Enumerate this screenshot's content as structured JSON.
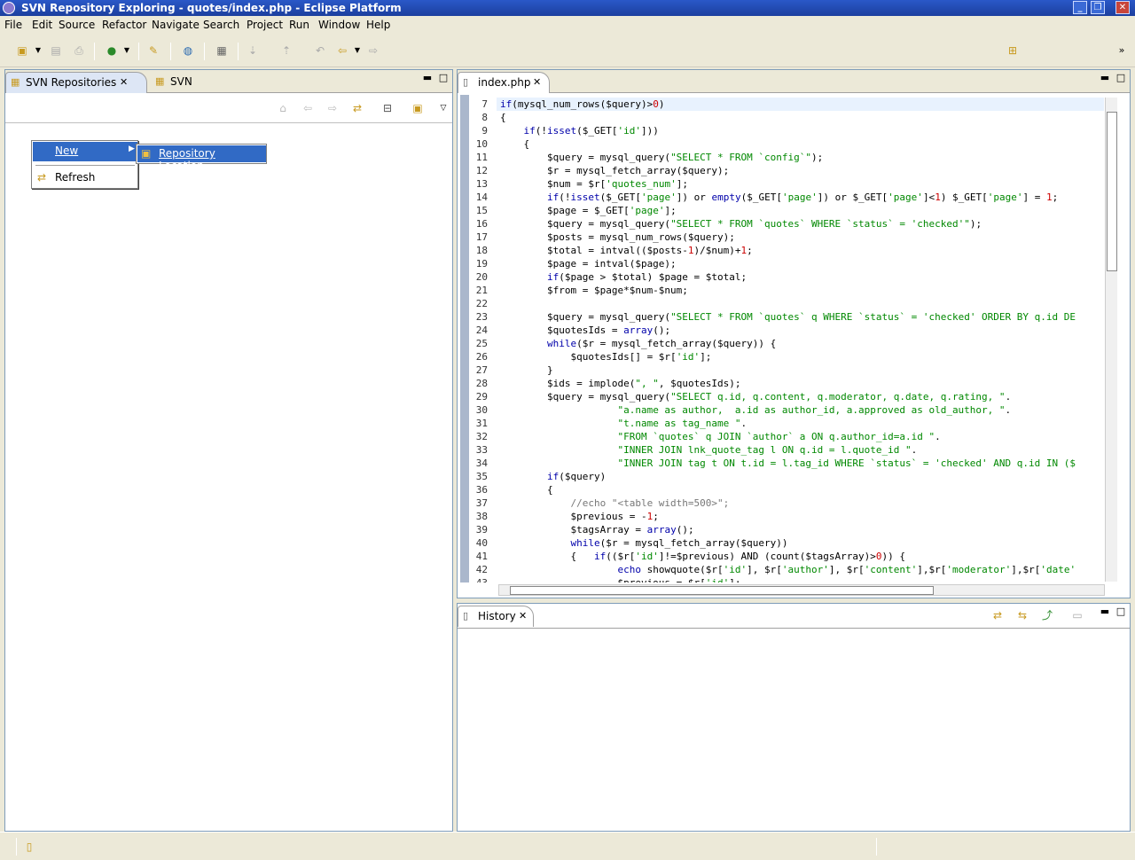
{
  "window": {
    "title": "SVN Repository Exploring - quotes/index.php - Eclipse Platform"
  },
  "menu": [
    "File",
    "Edit",
    "Source",
    "Refactor",
    "Navigate",
    "Search",
    "Project",
    "Run",
    "Window",
    "Help"
  ],
  "left_panel": {
    "tabs": [
      {
        "label": "SVN Repositories"
      },
      {
        "label": "SVN Annotate"
      }
    ],
    "context_menu": {
      "new_label": "New",
      "refresh_label": "Refresh",
      "submenu_item": "Repository Location..."
    }
  },
  "editor": {
    "tab_label": "index.php",
    "lines": [
      {
        "n": "7",
        "t": "if(mysql_num_rows($query)>0)"
      },
      {
        "n": "8",
        "t": "{"
      },
      {
        "n": "9",
        "t": "    if(!isset($_GET['id']))"
      },
      {
        "n": "10",
        "t": "    {"
      },
      {
        "n": "11",
        "t": "        $query = mysql_query(\"SELECT * FROM `config`\");"
      },
      {
        "n": "12",
        "t": "        $r = mysql_fetch_array($query);"
      },
      {
        "n": "13",
        "t": "        $num = $r['quotes_num'];"
      },
      {
        "n": "14",
        "t": "        if(!isset($_GET['page']) or empty($_GET['page']) or $_GET['page']<1) $_GET['page'] = 1;"
      },
      {
        "n": "15",
        "t": "        $page = $_GET['page'];"
      },
      {
        "n": "16",
        "t": "        $query = mysql_query(\"SELECT * FROM `quotes` WHERE `status` = 'checked'\");"
      },
      {
        "n": "17",
        "t": "        $posts = mysql_num_rows($query);"
      },
      {
        "n": "18",
        "t": "        $total = intval(($posts-1)/$num)+1;"
      },
      {
        "n": "19",
        "t": "        $page = intval($page);"
      },
      {
        "n": "20",
        "t": "        if($page > $total) $page = $total;"
      },
      {
        "n": "21",
        "t": "        $from = $page*$num-$num;"
      },
      {
        "n": "22",
        "t": ""
      },
      {
        "n": "23",
        "t": "        $query = mysql_query(\"SELECT * FROM `quotes` q WHERE `status` = 'checked' ORDER BY q.id DE"
      },
      {
        "n": "24",
        "t": "        $quotesIds = array();"
      },
      {
        "n": "25",
        "t": "        while($r = mysql_fetch_array($query)) {"
      },
      {
        "n": "26",
        "t": "            $quotesIds[] = $r['id'];"
      },
      {
        "n": "27",
        "t": "        }"
      },
      {
        "n": "28",
        "t": "        $ids = implode(\", \", $quotesIds);"
      },
      {
        "n": "29",
        "t": "        $query = mysql_query(\"SELECT q.id, q.content, q.moderator, q.date, q.rating, \"."
      },
      {
        "n": "30",
        "t": "                    \"a.name as author,  a.id as author_id, a.approved as old_author, \"."
      },
      {
        "n": "31",
        "t": "                    \"t.name as tag_name \"."
      },
      {
        "n": "32",
        "t": "                    \"FROM `quotes` q JOIN `author` a ON q.author_id=a.id \"."
      },
      {
        "n": "33",
        "t": "                    \"INNER JOIN lnk_quote_tag l ON q.id = l.quote_id \"."
      },
      {
        "n": "34",
        "t": "                    \"INNER JOIN tag t ON t.id = l.tag_id WHERE `status` = 'checked' AND q.id IN ($"
      },
      {
        "n": "35",
        "t": "        if($query)"
      },
      {
        "n": "36",
        "t": "        {"
      },
      {
        "n": "37",
        "t": "            //echo \"<table width=500>\";"
      },
      {
        "n": "38",
        "t": "            $previous = -1;"
      },
      {
        "n": "39",
        "t": "            $tagsArray = array();"
      },
      {
        "n": "40",
        "t": "            while($r = mysql_fetch_array($query))"
      },
      {
        "n": "41",
        "t": "            {   if(($r['id']!=$previous) AND (count($tagsArray)>0)) {"
      },
      {
        "n": "42",
        "t": "                    echo showquote($r['id'], $r['author'], $r['content'],$r['moderator'],$r['date'"
      },
      {
        "n": "43",
        "t": "                    $previous = $r['id'];"
      }
    ]
  },
  "history": {
    "tab_label": "History"
  },
  "colors": {
    "title_bar": "#1c3f9e",
    "selection": "#316ac5",
    "keyword": "#0000aa",
    "string": "#008800",
    "number": "#cc0000"
  }
}
